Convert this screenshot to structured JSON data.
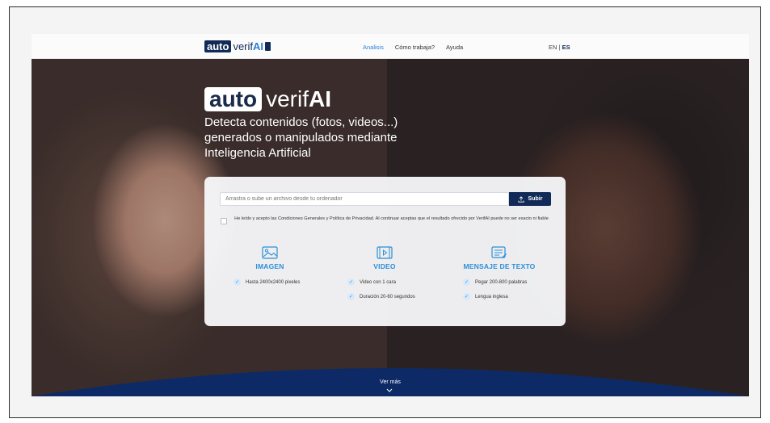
{
  "header": {
    "logo": {
      "box": "auto",
      "text": "verif",
      "ai": "AI"
    },
    "nav": [
      {
        "label": "Analisis",
        "active": true
      },
      {
        "label": "Cómo trabaja?",
        "active": false
      },
      {
        "label": "Ayuda",
        "active": false
      }
    ],
    "lang": {
      "en": "EN",
      "sep": "|",
      "es": "ES"
    }
  },
  "hero": {
    "logo": {
      "box": "auto",
      "text": "verif",
      "ai": "AI"
    },
    "tagline": "Detecta contenidos (fotos, videos...) generados o manipulados mediante Inteligencia Artificial"
  },
  "upload": {
    "placeholder": "Arrastra o sube un archivo desde tu ordenador",
    "button_label": "Subir",
    "button_icon": "upload-icon"
  },
  "terms": {
    "checked": false,
    "text": "He leído y acepto las Condiciones Generales y Política de Privacidad. Al continuar aceptas que el resultado ofrecido por VerifAI puede no ser exacto ni fiable"
  },
  "categories": [
    {
      "icon": "image-icon",
      "title": "IMAGEN",
      "features": [
        "Hasta 2400x2400 pixeles"
      ]
    },
    {
      "icon": "video-icon",
      "title": "VIDEO",
      "features": [
        "Video con 1 cara",
        "Duración 20-60 segundos"
      ]
    },
    {
      "icon": "text-message-icon",
      "title": "MENSAJE DE TEXTO",
      "features": [
        "Pegar 200-800 palabras",
        "Lengua inglesa"
      ]
    }
  ],
  "footer": {
    "ver_mas": "Ver más"
  },
  "colors": {
    "brand": "#112a57",
    "accent": "#2a8fd8",
    "wave": "#0e2a66"
  }
}
